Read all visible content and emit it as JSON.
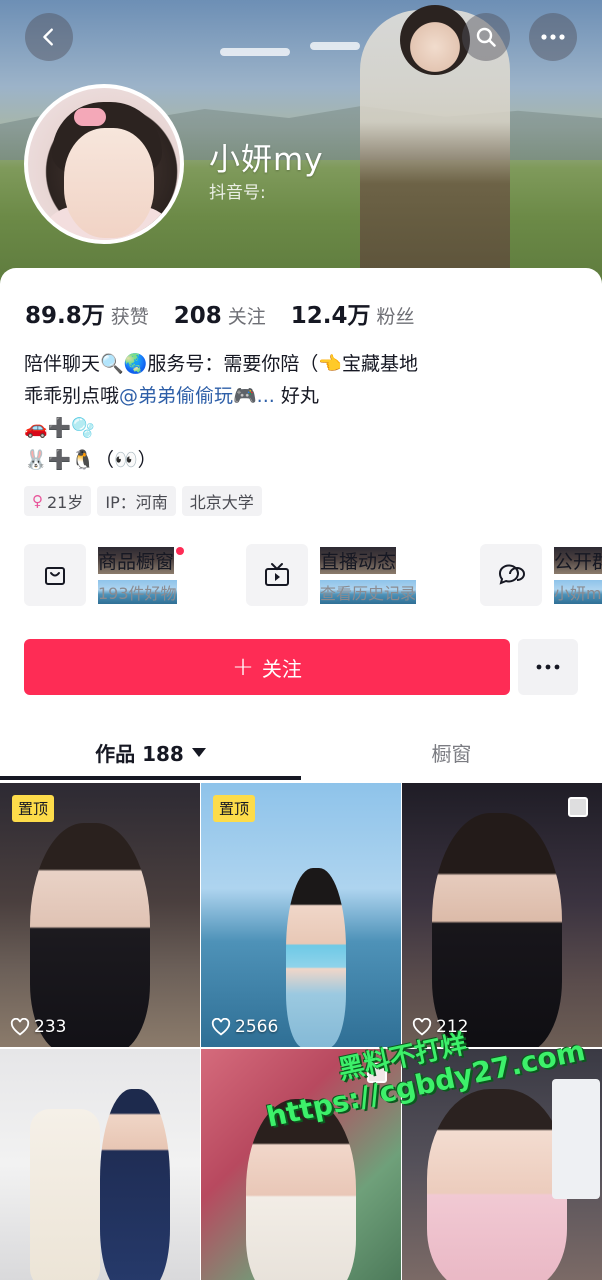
{
  "profile": {
    "nickname": "小妍my",
    "douyin_id_label": "抖音号:"
  },
  "stats": [
    {
      "value": "89.8万",
      "label": "获赞"
    },
    {
      "value": "208",
      "label": "关注"
    },
    {
      "value": "12.4万",
      "label": "粉丝"
    }
  ],
  "bio": {
    "line1": "陪伴聊天🔍🌏服务号：需要你陪（👈宝藏基地",
    "line2_prefix": "乖乖别点哦",
    "line2_mention": "@弟弟偷偷玩🎮...",
    "line2_suffix": " 好丸",
    "line3": "🚗➕🫧",
    "line4": "🐰➕🐧（👀）"
  },
  "tags": {
    "age": "21岁",
    "ip": "IP：河南",
    "school": "北京大学"
  },
  "services": [
    {
      "title": "商品橱窗",
      "subtitle": "193件好物",
      "icon": "shopping-bag-icon"
    },
    {
      "title": "直播动态",
      "subtitle": "查看历史记录",
      "icon": "tv-icon"
    },
    {
      "title": "公开群",
      "subtitle": "小妍my",
      "icon": "chat-icon"
    }
  ],
  "actions": {
    "follow_label": "关注"
  },
  "tabs": {
    "works_label": "作品 188",
    "window_label": "橱窗"
  },
  "videos": [
    {
      "pinned": "置顶",
      "likes": "233"
    },
    {
      "pinned": "置顶",
      "likes": "2566"
    },
    {
      "pinned": "",
      "likes": "212"
    },
    {
      "pinned": "",
      "likes": ""
    },
    {
      "pinned": "",
      "likes": ""
    },
    {
      "pinned": "",
      "likes": ""
    }
  ],
  "watermark": {
    "line1": "黑料不打烊",
    "line2": "https://cgbdy27.com"
  },
  "colors": {
    "accent": "#fe2c55",
    "pin_badge": "#fddc4a",
    "mention": "#2e5fa8",
    "watermark": "#3df06a"
  }
}
